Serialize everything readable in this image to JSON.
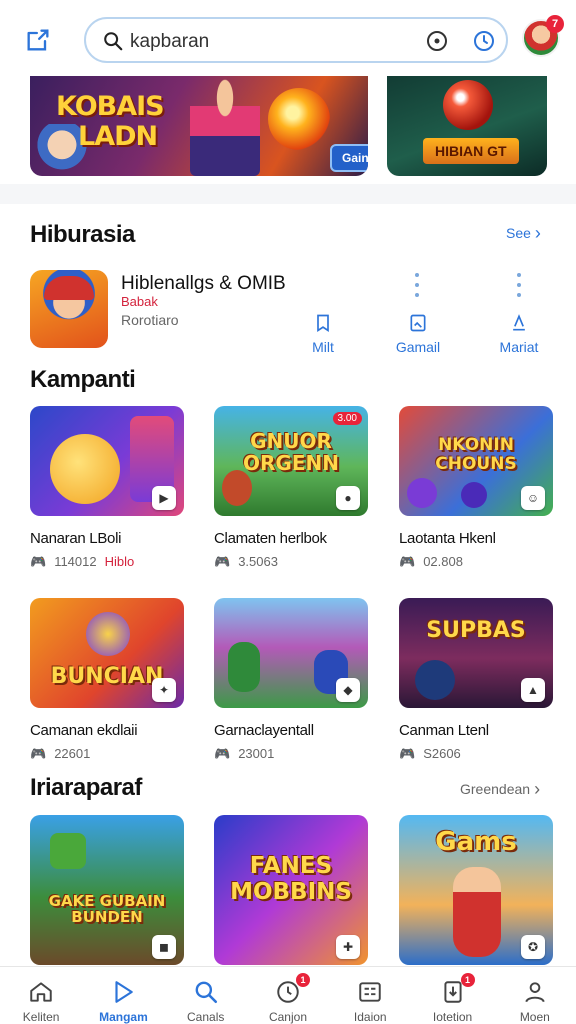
{
  "header": {
    "search_value": "kapbaran",
    "avatar_badge": "7"
  },
  "banners": [
    {
      "title_line1": "KOBAIS",
      "title_line2": "LADN",
      "cta": "Gainse"
    },
    {
      "cta": "HIBIAN GT"
    }
  ],
  "section1": {
    "title": "Hiburasia",
    "see_all": "See",
    "featured": {
      "name": "Hiblenallgs & OMIB",
      "tag": "Babak",
      "subtitle": "Rorotiaro",
      "actions": [
        "Milt",
        "Gamail",
        "Mariat"
      ]
    }
  },
  "section2": {
    "title": "Kampanti",
    "cards": [
      {
        "title": "Nanaran LBoli",
        "meta": "114012",
        "meta_red": "Hiblo",
        "art": "",
        "tag": ""
      },
      {
        "title": "Clamaten herlbok",
        "meta": "3.5063",
        "art": "GNUOR ORGENN",
        "tag": "3.00"
      },
      {
        "title": "Laotanta Hkenl",
        "meta": "02.808",
        "art": "NKONIN CHOUNS",
        "tag": ""
      },
      {
        "title": "Camanan ekdlaii",
        "meta": "22601",
        "art": "BUNCIAN",
        "tag": ""
      },
      {
        "title": "Garnaclayentall",
        "meta": "23001",
        "art": "",
        "tag": ""
      },
      {
        "title": "Canman Ltenl",
        "meta": "S2606",
        "art": "SUPBAS",
        "tag": ""
      }
    ]
  },
  "section3": {
    "title": "Iriaraparaf",
    "see_all": "Greendean",
    "cards": [
      {
        "art": "GAKE GUBAIN BUNDEN"
      },
      {
        "art": "FANES MOBBINS"
      },
      {
        "art": "Gams"
      }
    ]
  },
  "bottom_nav": [
    {
      "label": "Keliten",
      "icon": "home-icon",
      "badge": ""
    },
    {
      "label": "Mangam",
      "icon": "play-icon",
      "badge": ""
    },
    {
      "label": "Canals",
      "icon": "search-icon",
      "badge": ""
    },
    {
      "label": "Canjon",
      "icon": "clock-icon",
      "badge": "1"
    },
    {
      "label": "Idaion",
      "icon": "list-icon",
      "badge": ""
    },
    {
      "label": "Iotetion",
      "icon": "download-icon",
      "badge": "1"
    },
    {
      "label": "Moen",
      "icon": "person-icon",
      "badge": ""
    }
  ]
}
